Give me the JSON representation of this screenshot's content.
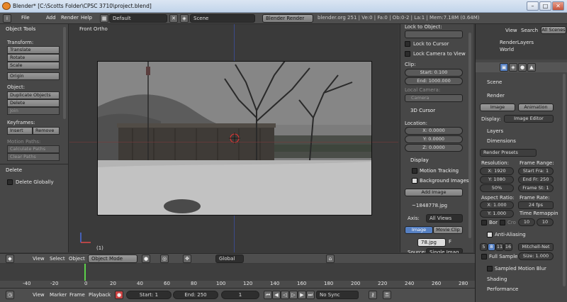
{
  "window": {
    "title": "Blender* [C:\\Scotts Folder\\CPSC 3710\\project.blend]",
    "min": "–",
    "max": "□",
    "close": "✕"
  },
  "topbar": {
    "menus": [
      "File",
      "Add",
      "Render",
      "Help"
    ],
    "layout": "Default",
    "scene": "Scene",
    "engine": "Blender Render",
    "stats": "blender.org 251 | Ve:0 | Fa:0 | Ob:0-2 | La:1 | Mem:7.18M (0.64M)"
  },
  "tools": {
    "panel_title": "Object Tools",
    "transform_label": "Transform:",
    "transform": [
      "Translate",
      "Rotate",
      "Scale"
    ],
    "origin": "Origin",
    "object_label": "Object:",
    "object_buttons": [
      "Duplicate Objects",
      "Delete",
      "Join"
    ],
    "keyframes_label": "Keyframes:",
    "insert": "Insert",
    "remove": "Remove",
    "motion_label": "Motion Paths:",
    "motion_buttons": [
      "Calculate Paths",
      "Clear Paths"
    ],
    "delete_panel": "Delete",
    "delete_globally": "Delete Globally"
  },
  "viewport": {
    "view_label": "Front Ortho",
    "frame_counter": "(1)"
  },
  "npanel": {
    "lock_label": "Lock to Object:",
    "lock_cursor": "Lock to Cursor",
    "lock_camera": "Lock Camera to View",
    "clip_label": "Clip:",
    "clip_start": "Start: 0.100",
    "clip_end": "End: 1000.000",
    "local_camera": "Local Camera:",
    "camera": "Camera",
    "cursor_panel": "3D Cursor",
    "location_label": "Location:",
    "cursor_x": "X: 0.0000",
    "cursor_y": "Y: 0.0000",
    "cursor_z": "Z: 0.0000",
    "display": "Display",
    "motion_tracking": "Motion Tracking",
    "background_images": "Background Images",
    "add_image": "Add Image",
    "image_name": "~1848778.jpg",
    "axis_label": "Axis:",
    "axis_value": "All Views",
    "tab_image": "Image",
    "tab_movie": "Movie Clip",
    "file_field": "78.jpg",
    "file_flag": "F",
    "source_label": "Source:",
    "source_value": "Single Imag"
  },
  "props": {
    "outliner_view": "View",
    "outliner_search": "Search",
    "outliner_scope": "All Scenes",
    "outliner_items": [
      "RenderLayers",
      "World"
    ],
    "breadcrumb": "Scene",
    "render_panel": "Render",
    "image_btn": "Image",
    "animation_btn": "Animation",
    "display_label": "Display:",
    "display_value": "Image Editor",
    "layers": "Layers",
    "dimensions": "Dimensions",
    "presets": "Render Presets",
    "resolution_label": "Resolution:",
    "res_x": "X: 1920",
    "res_y": "Y: 1080",
    "res_pct": "50%",
    "frame_range_label": "Frame Range:",
    "start_frame": "Start Fra: 1",
    "end_frame": "End Fr: 250",
    "frame_step": "Frame St: 1",
    "aspect_label": "Aspect Ratio:",
    "aspect_x": "X: 1.000",
    "aspect_y": "Y: 1.000",
    "frame_rate_label": "Frame Rate:",
    "fps": "24 fps",
    "time_remap": "Time Remappin",
    "remap_old": "10",
    "remap_new": "10",
    "bor": "Bor",
    "cro": "Cro",
    "anti_aliasing": "Anti-Aliasing",
    "aa_samples": [
      "5",
      "8",
      "11",
      "16"
    ],
    "aa_filter": "Mitchell-Net",
    "full_sample": "Full Sample",
    "aa_size": "Size: 1.000",
    "sampled_motion_blur": "Sampled Motion Blur",
    "shading": "Shading",
    "performance": "Performance"
  },
  "view3d_header": {
    "view": "View",
    "select": "Select",
    "object": "Object",
    "mode": "Object Mode",
    "orientation": "Global"
  },
  "timeline": {
    "ticks": [
      "-40",
      "-20",
      "0",
      "20",
      "40",
      "60",
      "80",
      "100",
      "120",
      "140",
      "160",
      "180",
      "200",
      "220",
      "240",
      "260",
      "280"
    ],
    "view": "View",
    "marker": "Marker",
    "frame": "Frame",
    "playback": "Playback",
    "start": "Start: 1",
    "end": "End: 250",
    "current": "1",
    "sync": "No Sync"
  }
}
